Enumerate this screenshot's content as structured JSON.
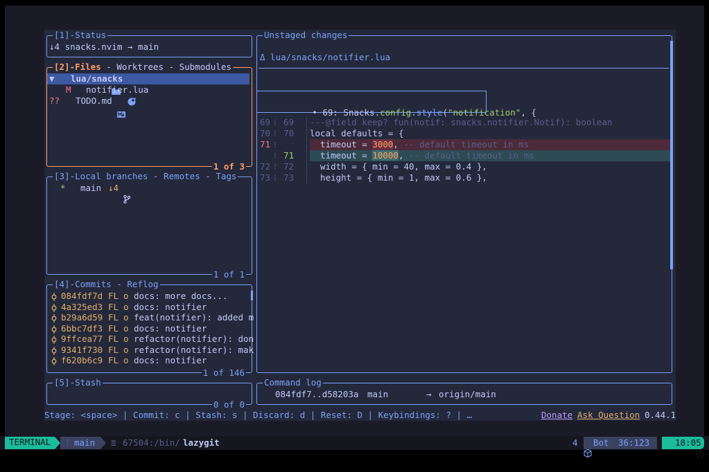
{
  "status_panel": {
    "title": "[1]-Status",
    "branch_info": "↓4 snacks.nvim → main"
  },
  "files_panel": {
    "title_active": "[2]-Files",
    "title_rest": " - Worktrees - Submodules",
    "items": [
      {
        "prefix": "▼ ",
        "label": "lua/snacks"
      },
      {
        "prefix": "M ",
        "label": "notifier.lua"
      },
      {
        "prefix": "?? ",
        "label": "TODO.md"
      }
    ],
    "footer": "1 of 3"
  },
  "branches_panel": {
    "title": "[3]-Local branches",
    "title_sep1": " - ",
    "title_remotes": "Remotes",
    "title_sep2": " - ",
    "title_tags": "Tags",
    "branch_star": "*",
    "branch_name": "main",
    "branch_behind": "↓4",
    "footer": "1 of 1"
  },
  "commits_panel": {
    "title": "[4]-Commits",
    "title_rest": " - Reflog",
    "commits": [
      {
        "hash": "084fdf7d",
        "author": "FL",
        "msg": "docs: more docs..."
      },
      {
        "hash": "4a325ed3",
        "author": "FL",
        "msg": "docs: notifier"
      },
      {
        "hash": "b29a6d59",
        "author": "FL",
        "msg": "feat(notifier): added m"
      },
      {
        "hash": "6bbc7df3",
        "author": "FL",
        "msg": "docs: notifier"
      },
      {
        "hash": "9ffcea77",
        "author": "FL",
        "msg": "refactor(notifier): don"
      },
      {
        "hash": "9341f730",
        "author": "FL",
        "msg": "refactor(notifier): mak"
      },
      {
        "hash": "f620b6c9",
        "author": "FL",
        "msg": "docs: notifier"
      }
    ],
    "footer": "1 of 146"
  },
  "stash_panel": {
    "title": "[5]-Stash",
    "footer": "0 of 0"
  },
  "diff_panel": {
    "title": "Unstaged changes",
    "file_header": "Δ lua/snacks/notifier.lua",
    "hunk_header_prefix": "• 69: ",
    "hunk_obj": "Snacks",
    "hunk_dot1": ".",
    "hunk_prop": "config",
    "hunk_dot2": ".",
    "hunk_fn": "style",
    "hunk_paren": "(",
    "hunk_str": "\"notification\"",
    "hunk_tail": ", {",
    "lines": [
      {
        "old": "69",
        "new": "69",
        "code": "---@field keep? fun(notif: snacks.notifier.Notif): boolean"
      },
      {
        "old": "70",
        "new": "70",
        "kw": "local",
        "code": " defaults = {"
      },
      {
        "old": "71",
        "new": "",
        "pre": "  timeout = ",
        "num": "3000",
        "post": ",",
        "comment": " -- default timeout in ms"
      },
      {
        "old": "",
        "new": "71",
        "pre": "  timeout = ",
        "num": "10000",
        "post": ",",
        "comment": " -- default timeout in ms"
      },
      {
        "old": "72",
        "new": "72",
        "code": "  width = { min = 40, max = 0.4 },"
      },
      {
        "old": "73",
        "new": "73",
        "code": "  height = { min = 1, max = 0.6 },"
      }
    ]
  },
  "command_log": {
    "title": "Command log",
    "entry_range": "084fdf7..d58203a",
    "entry_branch": "main",
    "entry_arrow": "→",
    "entry_target": "origin/main"
  },
  "bottom_bar": {
    "hints": "Stage: <space> | Commit: c | Stash: s | Discard: d | Reset: D | Keybindings: ? | …",
    "donate": "Donate",
    "ask": "Ask Question",
    "version": "0.44.1"
  },
  "statusline": {
    "mode": "TERMINAL",
    "git_icon_branch": "main",
    "term_path_num": "67504:/bin/",
    "term_cmd": "lazygit",
    "count": "4",
    "position": "Bot",
    "line_col": "36:123",
    "time": "18:05"
  },
  "colors": {
    "accent": "#7aa2f7",
    "active": "#ff9e64",
    "mode_bg": "#1abc9c",
    "bg": "#24283b"
  }
}
